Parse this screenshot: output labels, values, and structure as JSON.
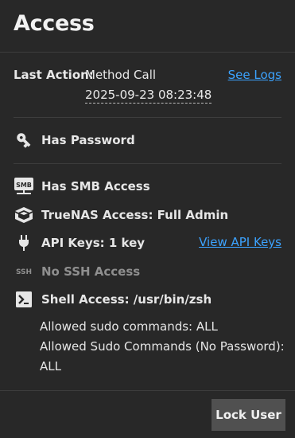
{
  "card": {
    "title": "Access"
  },
  "last_action": {
    "label": "Last Action:",
    "method": "Method Call",
    "datetime": "2025-09-23 08:23:48",
    "see_logs_label": "See Logs"
  },
  "password": {
    "icon": "key-icon",
    "label": "Has Password"
  },
  "access_items": [
    {
      "icon": "smb-icon",
      "icon_text": "SMB",
      "label": "Has SMB Access"
    },
    {
      "icon": "truenas-logo-icon",
      "label": "TrueNAS Access: Full Admin"
    },
    {
      "icon": "plug-icon",
      "label": "API Keys: 1 key",
      "link_label": "View API Keys"
    },
    {
      "icon": "ssh-icon",
      "icon_text": "SSH",
      "label": "No SSH Access"
    },
    {
      "icon": "terminal-icon",
      "label": "Shell Access: /usr/bin/zsh"
    }
  ],
  "sudo": {
    "allowed": "Allowed sudo commands: ALL",
    "allowed_nopass_line1": "Allowed Sudo Commands (No Password):",
    "allowed_nopass_line2": "ALL"
  },
  "actions": {
    "lock_user_label": "Lock User"
  },
  "colors": {
    "background": "#282828",
    "link": "#3ca3ff",
    "button": "#505050"
  }
}
